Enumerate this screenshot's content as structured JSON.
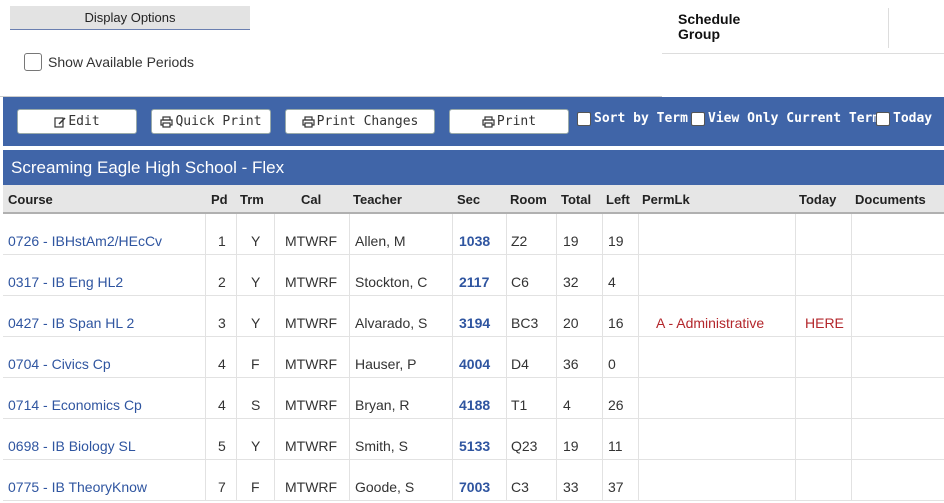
{
  "display_options": {
    "title": "Display Options",
    "show_available_label": "Show Available Periods"
  },
  "schedule_group": {
    "label": "Schedule Group"
  },
  "toolbar": {
    "edit": "Edit",
    "quick_print": "Quick Print",
    "print_changes": "Print Changes",
    "print": "Print",
    "sort_by_term": "Sort by Term",
    "view_only_current_term": "View Only Current Term",
    "today": "Today"
  },
  "school": {
    "name": "Screaming Eagle High School - Flex"
  },
  "table": {
    "columns": {
      "course": "Course",
      "pd": "Pd",
      "trm": "Trm",
      "cal": "Cal",
      "teacher": "Teacher",
      "sec": "Sec",
      "room": "Room",
      "total": "Total",
      "left": "Left",
      "permlk": "PermLk",
      "today": "Today",
      "documents": "Documents"
    },
    "rows": [
      {
        "course": "0726 - IBHstAm2/HEcCv",
        "pd": "1",
        "trm": "Y",
        "cal": "MTWRF",
        "teacher": "Allen, M",
        "sec": "1038",
        "room": "Z2",
        "total": "19",
        "left": "19",
        "permlk": "",
        "today": ""
      },
      {
        "course": "0317 - IB Eng HL2",
        "pd": "2",
        "trm": "Y",
        "cal": "MTWRF",
        "teacher": "Stockton, C",
        "sec": "2117",
        "room": "C6",
        "total": "32",
        "left": "4",
        "permlk": "",
        "today": ""
      },
      {
        "course": "0427 - IB Span HL 2",
        "pd": "3",
        "trm": "Y",
        "cal": "MTWRF",
        "teacher": "Alvarado, S",
        "sec": "3194",
        "room": "BC3",
        "total": "20",
        "left": "16",
        "permlk": "A - Administrative",
        "today": "HERE"
      },
      {
        "course": "0704 - Civics Cp",
        "pd": "4",
        "trm": "F",
        "cal": "MTWRF",
        "teacher": "Hauser, P",
        "sec": "4004",
        "room": "D4",
        "total": "36",
        "left": "0",
        "permlk": "",
        "today": ""
      },
      {
        "course": "0714 - Economics Cp",
        "pd": "4",
        "trm": "S",
        "cal": "MTWRF",
        "teacher": "Bryan, R",
        "sec": "4188",
        "room": "T1",
        "total": "4",
        "left": "26",
        "permlk": "",
        "today": ""
      },
      {
        "course": "0698 - IB Biology SL",
        "pd": "5",
        "trm": "Y",
        "cal": "MTWRF",
        "teacher": "Smith, S",
        "sec": "5133",
        "room": "Q23",
        "total": "19",
        "left": "11",
        "permlk": "",
        "today": ""
      },
      {
        "course": "0775 - IB TheoryKnow",
        "pd": "7",
        "trm": "F",
        "cal": "MTWRF",
        "teacher": "Goode, S",
        "sec": "7003",
        "room": "C3",
        "total": "33",
        "left": "37",
        "permlk": "",
        "today": ""
      }
    ]
  }
}
